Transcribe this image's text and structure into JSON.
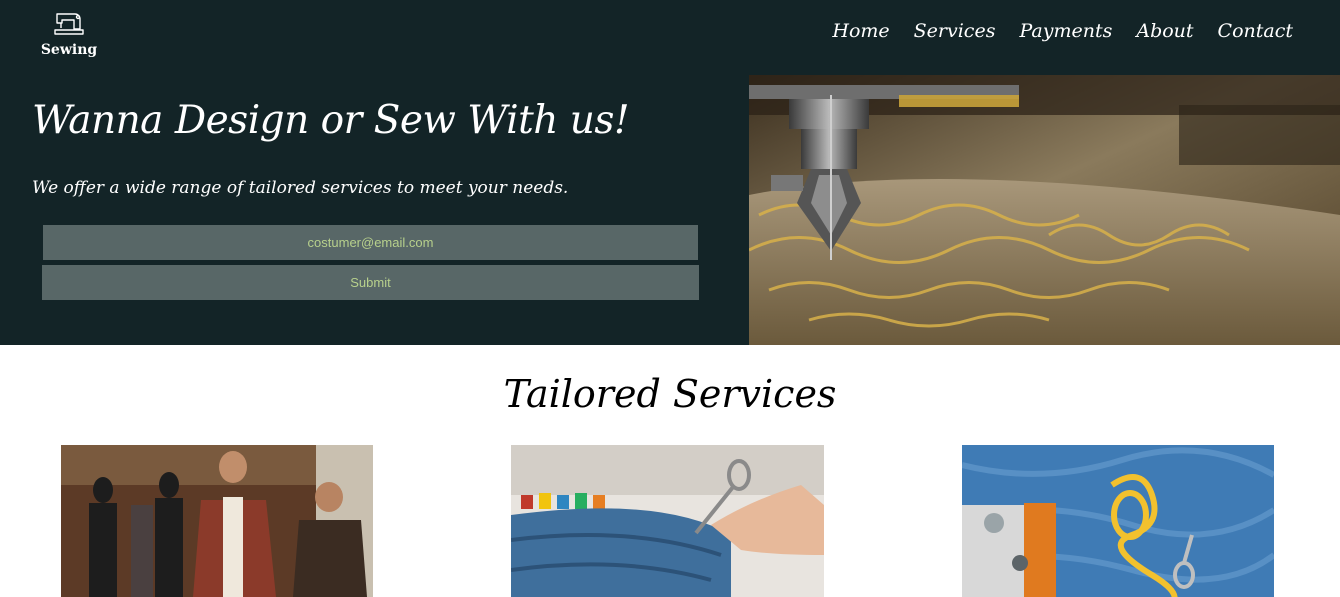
{
  "brand": {
    "name": "Sewing",
    "icon": "sewing-machine-icon"
  },
  "nav": {
    "items": [
      {
        "label": "Home"
      },
      {
        "label": "Services"
      },
      {
        "label": "Payments"
      },
      {
        "label": "About"
      },
      {
        "label": "Contact"
      }
    ]
  },
  "hero": {
    "title": "Wanna Design or Sew With us!",
    "subtitle": "We offer a wide range of tailored services to meet your needs.",
    "email_placeholder": "costumer@email.com",
    "submit_label": "Submit"
  },
  "services": {
    "title": "Tailored Services"
  },
  "colors": {
    "header_bg": "#132427",
    "input_bg": "#586767",
    "input_text": "#b7d08c",
    "text_light": "#ffffff"
  }
}
